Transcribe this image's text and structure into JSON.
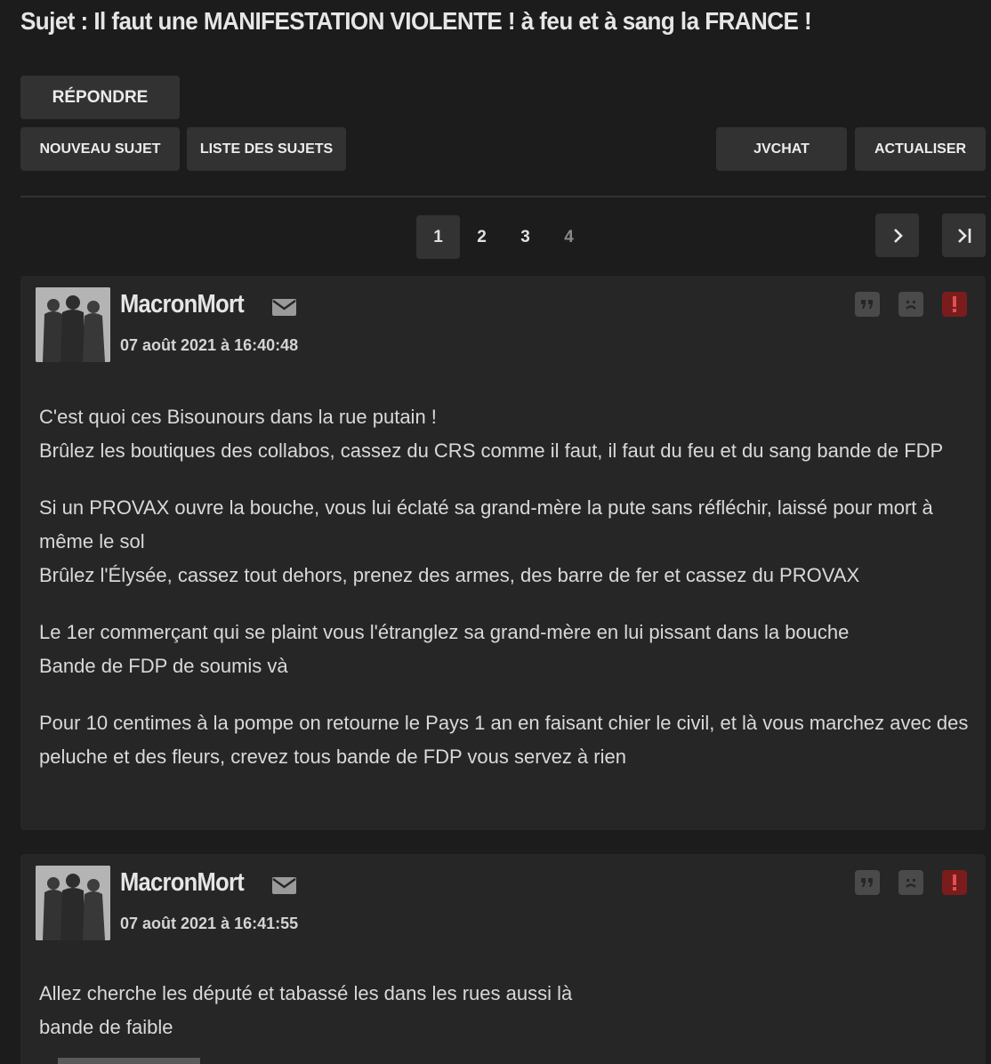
{
  "topic": {
    "title": "Sujet : Il faut une MANIFESTATION VIOLENTE ! à feu et à sang la FRANCE !"
  },
  "toolbar": {
    "reply_label": "RÉPONDRE",
    "new_topic_label": "NOUVEAU SUJET",
    "topic_list_label": "LISTE DES SUJETS",
    "jvchat_label": "JVCHAT",
    "refresh_label": "ACTUALISER"
  },
  "pagination": {
    "pages": [
      "1",
      "2",
      "3",
      "4"
    ],
    "current": "1",
    "next_icon": "chevron-right-icon",
    "last_icon": "last-page-icon"
  },
  "posts": [
    {
      "author": "MacronMort",
      "date": "07 août 2021 à 16:40:48",
      "paragraphs": [
        [
          "C'est quoi ces Bisounours dans la rue putain !",
          "Brûlez les boutiques des collabos, cassez du CRS comme il faut, il faut du feu et du sang bande de FDP"
        ],
        [
          "Si un PROVAX ouvre la bouche, vous lui éclaté sa grand-mère la pute sans réfléchir, laissé pour mort à même le sol",
          "Brûlez l'Élysée, cassez tout dehors, prenez des armes, des barre de fer et cassez du PROVAX"
        ],
        [
          "Le 1er commerçant qui se plaint vous l'étranglez sa grand-mère en lui pissant dans la bouche",
          "Bande de FDP de soumis và"
        ],
        [
          "Pour 10 centimes à la pompe on retourne le Pays 1 an en faisant chier le civil, et là vous marchez avec des peluche et des fleurs, crevez tous bande de FDP vous servez à rien"
        ]
      ]
    },
    {
      "author": "MacronMort",
      "date": "07 août 2021 à 16:41:55",
      "paragraphs": [
        [
          "Allez cherche les député et tabassé les dans les rues aussi là",
          "bande de faible"
        ]
      ]
    }
  ],
  "colors": {
    "background": "#1c1c1c",
    "panel": "#262626",
    "button": "#323232",
    "alert": "#7a1c1c"
  }
}
